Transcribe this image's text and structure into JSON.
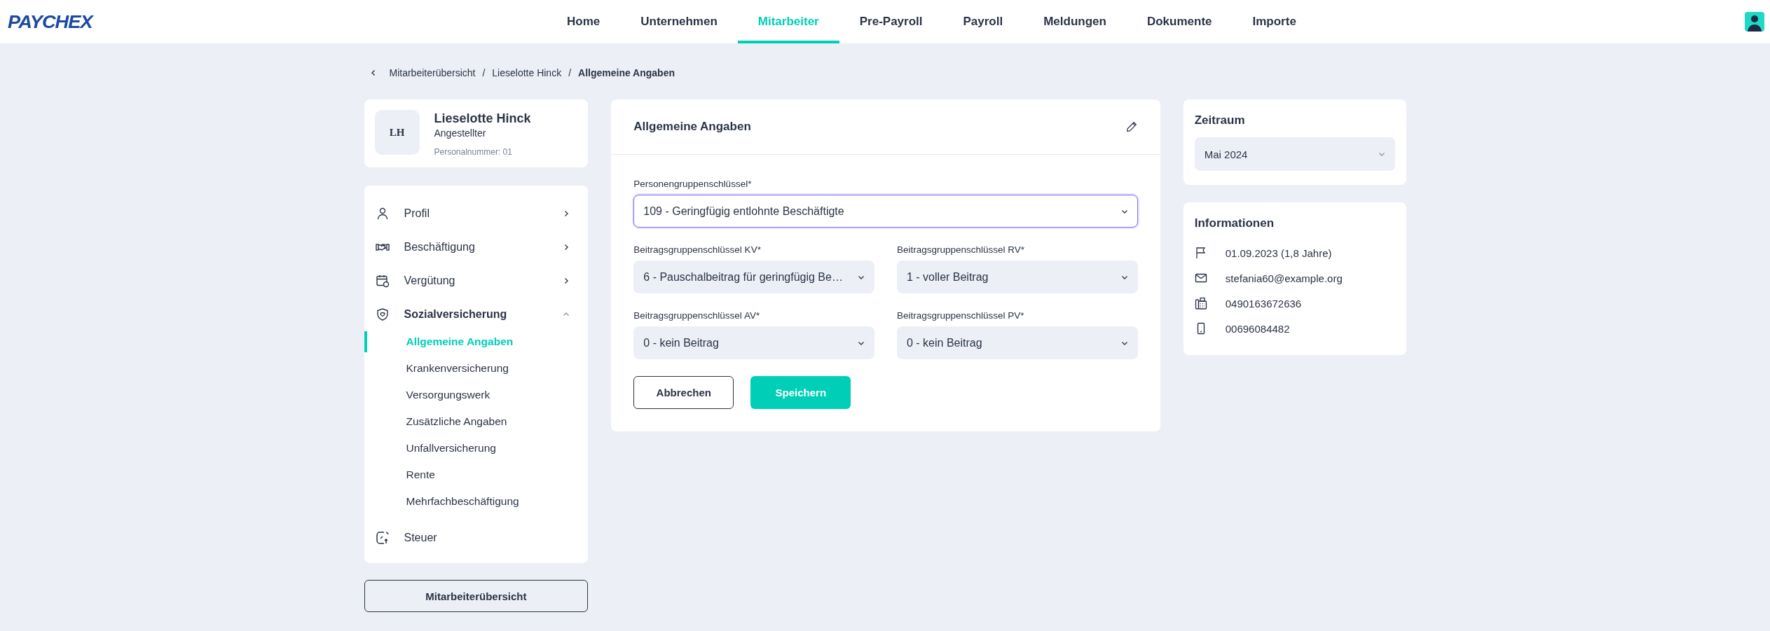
{
  "header": {
    "logo": "PAYCHEX",
    "nav": [
      {
        "label": "Home",
        "selected": false
      },
      {
        "label": "Unternehmen",
        "selected": false
      },
      {
        "label": "Mitarbeiter",
        "selected": true
      },
      {
        "label": "Pre-Payroll",
        "selected": false
      },
      {
        "label": "Payroll",
        "selected": false
      },
      {
        "label": "Meldungen",
        "selected": false
      },
      {
        "label": "Dokumente",
        "selected": false
      },
      {
        "label": "Importe",
        "selected": false
      }
    ]
  },
  "breadcrumb": {
    "items": [
      "Mitarbeiterübersicht",
      "Lieselotte Hinck",
      "Allgemeine Angaben"
    ],
    "separators": [
      "/",
      "/"
    ]
  },
  "profile": {
    "initials": "LH",
    "name": "Lieselotte Hinck",
    "role": "Angestellter",
    "personnel_number": "Personalnummer:  01"
  },
  "sidebar": {
    "items": [
      {
        "label": "Profil",
        "kind": "expandable",
        "expanded": false
      },
      {
        "label": "Beschäftigung",
        "kind": "expandable",
        "expanded": false
      },
      {
        "label": "Vergütung",
        "kind": "expandable",
        "expanded": false
      },
      {
        "label": "Sozialversicherung",
        "kind": "expandable",
        "expanded": true,
        "children": [
          {
            "label": "Allgemeine Angaben",
            "selected": true
          },
          {
            "label": "Krankenversicherung",
            "selected": false
          },
          {
            "label": "Versorgungswerk",
            "selected": false
          },
          {
            "label": "Zusätzliche Angaben",
            "selected": false
          },
          {
            "label": "Unfallversicherung",
            "selected": false
          },
          {
            "label": "Rente",
            "selected": false
          },
          {
            "label": "Mehrfachbeschäftigung",
            "selected": false
          }
        ]
      },
      {
        "label": "Steuer",
        "kind": "link",
        "expanded": false
      }
    ]
  },
  "overview_button": "Mitarbeiterübersicht",
  "form": {
    "title": "Allgemeine Angaben",
    "person_group": {
      "label": "Personengruppenschlüssel*",
      "value": "109 - Geringfügig entlohnte Beschäftigte",
      "focused": true
    },
    "fields": [
      {
        "label": "Beitragsgruppenschlüssel KV*",
        "value": "6 - Pauschalbeitrag für geringfügig Be…",
        "focused": false
      },
      {
        "label": "Beitragsgruppenschlüssel RV*",
        "value": "1 - voller Beitrag",
        "focused": false
      },
      {
        "label": "Beitragsgruppenschlüssel AV*",
        "value": "0 - kein Beitrag",
        "focused": false
      },
      {
        "label": "Beitragsgruppenschlüssel PV*",
        "value": "0 - kein Beitrag",
        "focused": false
      }
    ],
    "cancel": "Abbrechen",
    "save": "Speichern"
  },
  "period": {
    "title": "Zeitraum",
    "value": "Mai 2024"
  },
  "info": {
    "title": "Informationen",
    "items": [
      "01.09.2023 (1,8 Jahre)",
      "stefania60@example.org",
      "0490163672636",
      "00696084482"
    ]
  }
}
